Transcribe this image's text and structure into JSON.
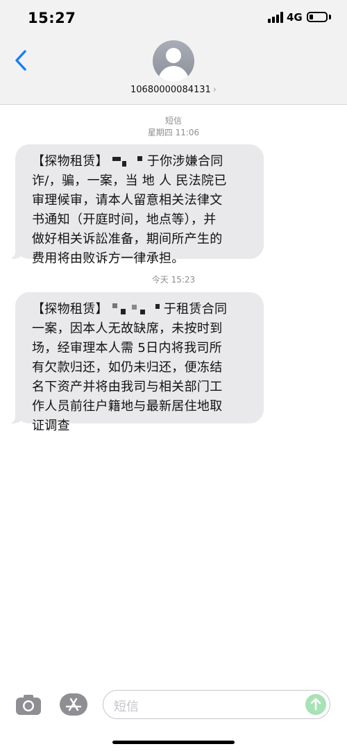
{
  "status_bar": {
    "time": "15:27",
    "network": "4G",
    "battery_level": 0.15
  },
  "header": {
    "contact": "10680000084131",
    "chevron": "›",
    "back_icon": "chevron-left-icon",
    "avatar_icon": "person-icon"
  },
  "messages": [
    {
      "stamp_label": "短信",
      "stamp_time": "星期四 11:06",
      "lines": [
        {
          "pre": "【探物租赁】",
          "post": "于你涉嫌合同"
        },
        {
          "text": "诈/，骗，一案，当 地 人 民法院已"
        },
        {
          "text": "审理候审，请本人留意相关法律文"
        },
        {
          "text": "书通知（开庭时间，地点等），并"
        },
        {
          "text": "做好相关诉訟准备，期间所产生的"
        },
        {
          "text": "费用将由败诉方一律承担。"
        }
      ]
    },
    {
      "stamp_time": "今天 15:23",
      "lines": [
        {
          "pre": "【探物租赁】",
          "post": "于租赁合同"
        },
        {
          "text": "一案，因本人无故缺席，未按时到"
        },
        {
          "text": "场，经审理本人需 5日内将我司所"
        },
        {
          "text": "有欠款归还，如仍未归还，便冻结"
        },
        {
          "text": "名下资产并将由我司与相关部门工"
        },
        {
          "text": "作人员前往户籍地与最新居住地取"
        },
        {
          "text": "证调查"
        }
      ]
    }
  ],
  "input_bar": {
    "placeholder": "短信",
    "camera_icon": "camera-icon",
    "apps_icon": "app-store-icon",
    "send_icon": "send-arrow-icon",
    "send_color": "#a8e2b5"
  },
  "colors": {
    "bubble": "#e9e9eb",
    "accent": "#147efb",
    "header_bg": "#f2f2f2"
  }
}
